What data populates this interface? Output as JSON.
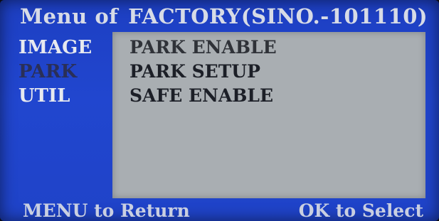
{
  "header": {
    "menu_label": "Menu of",
    "device_name": "FACTORY(SINO.-101110)"
  },
  "sidebar": {
    "items": [
      {
        "label": "IMAGE",
        "active": false
      },
      {
        "label": "PARK",
        "active": true
      },
      {
        "label": "UTIL",
        "active": false
      }
    ]
  },
  "panel": {
    "items": [
      {
        "label": "PARK ENABLE"
      },
      {
        "label": "PARK SETUP"
      },
      {
        "label": "SAFE ENABLE"
      }
    ]
  },
  "footer": {
    "left_hint": "MENU to Return",
    "right_hint": "OK to Select"
  },
  "colors": {
    "background": "#2146cf",
    "panel": "#a9aeb2",
    "text_light": "#e7e9ef",
    "text_dark": "#1c1f27",
    "active_side": "#2a2f57"
  }
}
